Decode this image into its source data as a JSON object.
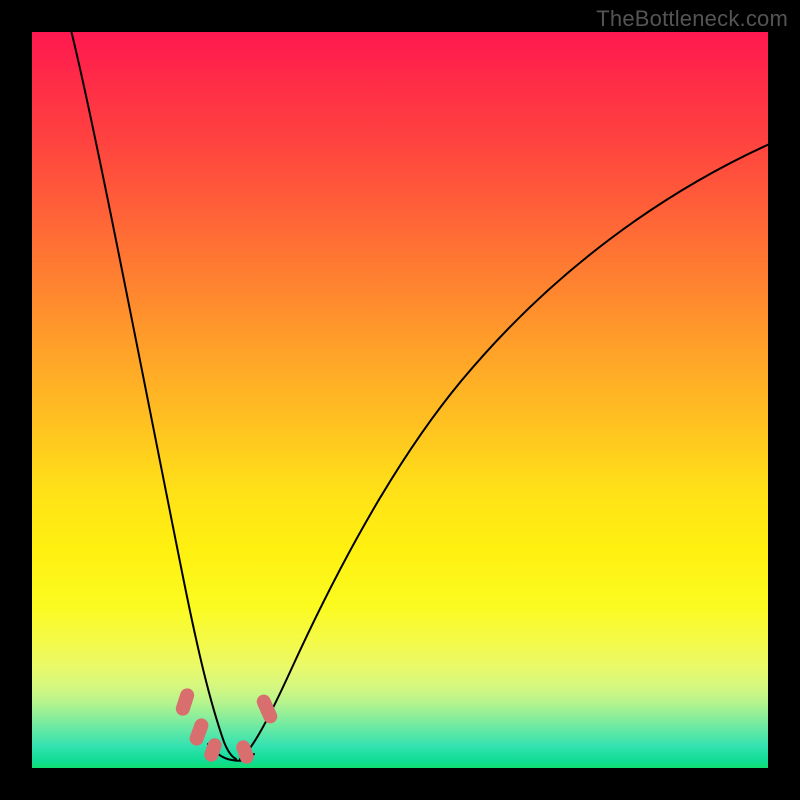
{
  "watermark": "TheBottleneck.com",
  "chart_data": {
    "type": "line",
    "title": "",
    "xlabel": "",
    "ylabel": "",
    "xlim": [
      0,
      100
    ],
    "ylim": [
      0,
      100
    ],
    "background": {
      "type": "vertical-gradient",
      "stops": [
        {
          "pct": 0,
          "color": "#ff1850"
        },
        {
          "pct": 50,
          "color": "#ffb024"
        },
        {
          "pct": 80,
          "color": "#f8fa40"
        },
        {
          "pct": 100,
          "color": "#10dd70"
        }
      ],
      "meaning": "color encodes y-value (red high, green low)"
    },
    "series": [
      {
        "name": "left-branch",
        "x": [
          5,
          7,
          9,
          11,
          13,
          15,
          17,
          19,
          21,
          22,
          23,
          25,
          27
        ],
        "y": [
          100,
          90,
          80,
          70,
          60,
          50,
          40,
          30,
          20,
          14,
          10,
          5,
          3
        ],
        "note": "steep descent into valley"
      },
      {
        "name": "right-branch",
        "x": [
          27,
          30,
          33,
          37,
          42,
          48,
          55,
          63,
          72,
          82,
          92,
          100
        ],
        "y": [
          3,
          6,
          12,
          22,
          34,
          46,
          56,
          64,
          71,
          77,
          82,
          85
        ],
        "note": "concave ascent, flattening toward right"
      },
      {
        "name": "valley-floor",
        "x": [
          23,
          25,
          27,
          29,
          30
        ],
        "y": [
          3,
          2.5,
          2.5,
          3,
          5
        ]
      }
    ],
    "markers": [
      {
        "x": 20.5,
        "y": 9,
        "shape": "rounded-rect",
        "color": "#d96e6e"
      },
      {
        "x": 22.5,
        "y": 5,
        "shape": "rounded-rect",
        "color": "#d96e6e"
      },
      {
        "x": 24,
        "y": 3.5,
        "shape": "rounded-rect",
        "color": "#d96e6e"
      },
      {
        "x": 29,
        "y": 3.5,
        "shape": "rounded-rect",
        "color": "#d96e6e"
      },
      {
        "x": 32,
        "y": 9,
        "shape": "rounded-rect",
        "color": "#d96e6e"
      }
    ],
    "grid": false,
    "legend": false
  }
}
